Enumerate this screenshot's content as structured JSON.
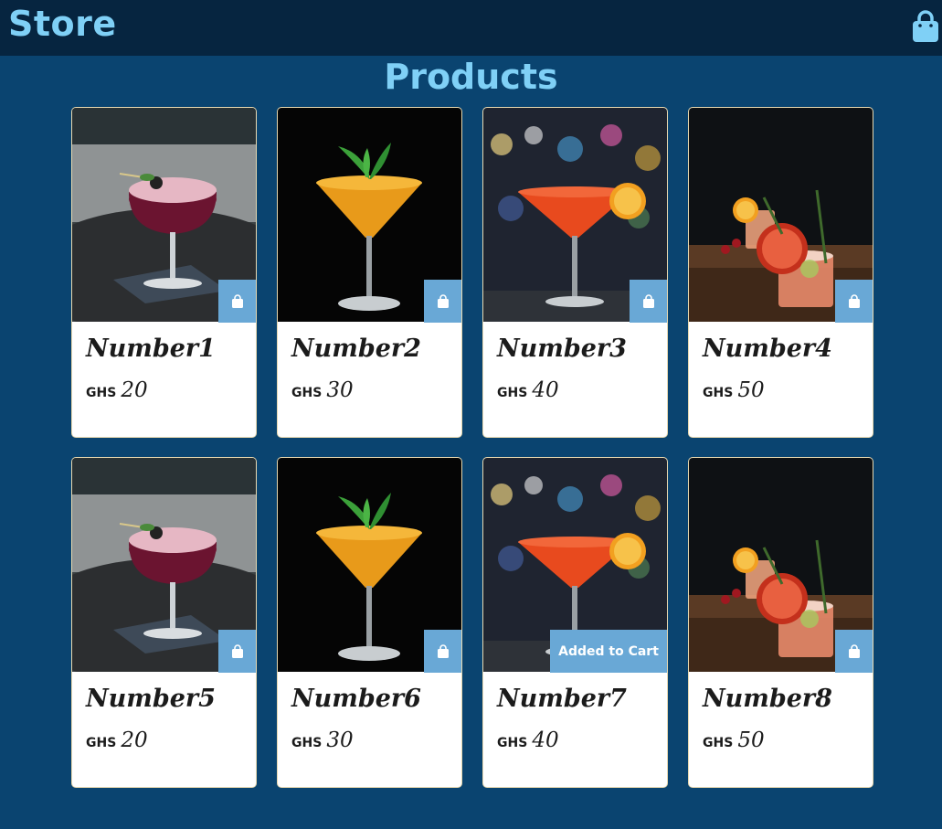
{
  "header": {
    "brand": "Store",
    "cart_icon": "shopping-bag-icon"
  },
  "page": {
    "title": "Products"
  },
  "colors": {
    "topbar": "#062540",
    "background": "#0a4470",
    "accent": "#7fd0f6",
    "button": "#69a8d6"
  },
  "products": [
    {
      "name": "Number1",
      "currency": "GHS",
      "price": "20",
      "image": "berry-coupe-cocktail",
      "cart_state": ""
    },
    {
      "name": "Number2",
      "currency": "GHS",
      "price": "30",
      "image": "orange-martini-mint",
      "cart_state": ""
    },
    {
      "name": "Number3",
      "currency": "GHS",
      "price": "40",
      "image": "red-martini-bar-lights",
      "cart_state": ""
    },
    {
      "name": "Number4",
      "currency": "GHS",
      "price": "50",
      "image": "grapefruit-rosemary-cocktail",
      "cart_state": ""
    },
    {
      "name": "Number5",
      "currency": "GHS",
      "price": "20",
      "image": "berry-coupe-cocktail",
      "cart_state": ""
    },
    {
      "name": "Number6",
      "currency": "GHS",
      "price": "30",
      "image": "orange-martini-mint",
      "cart_state": ""
    },
    {
      "name": "Number7",
      "currency": "GHS",
      "price": "40",
      "image": "red-martini-bar-lights",
      "cart_state": "Added to Cart"
    },
    {
      "name": "Number8",
      "currency": "GHS",
      "price": "50",
      "image": "grapefruit-rosemary-cocktail",
      "cart_state": ""
    }
  ]
}
